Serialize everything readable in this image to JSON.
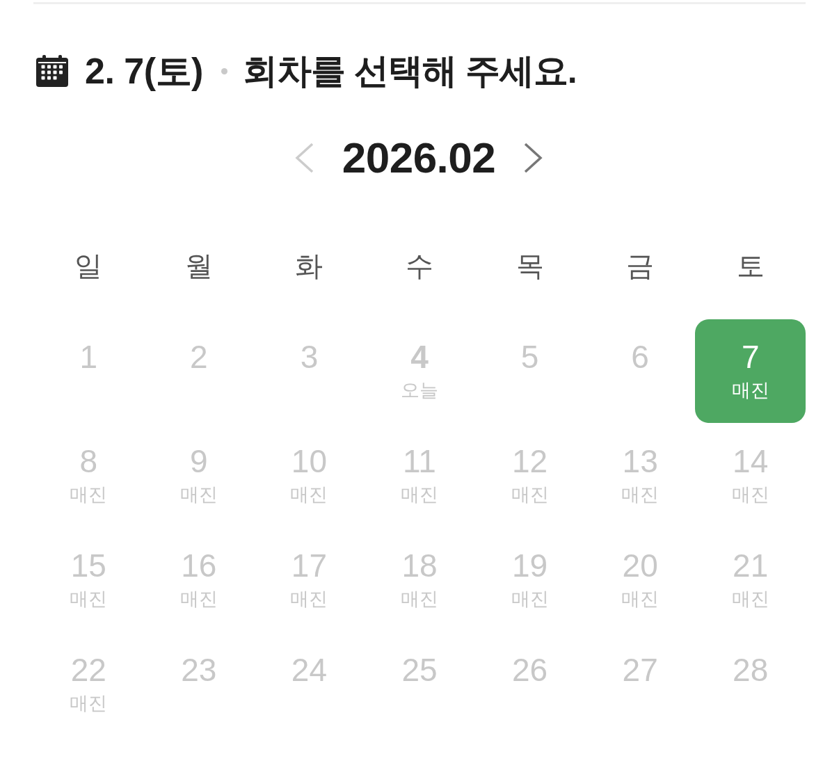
{
  "header": {
    "date": "2. 7(토)",
    "title": "회차를 선택해 주세요."
  },
  "month_nav": {
    "label": "2026.02",
    "prev": {
      "disabled": true
    },
    "next": {
      "disabled": false
    }
  },
  "weekdays": [
    "일",
    "월",
    "화",
    "수",
    "목",
    "금",
    "토"
  ],
  "days": [
    {
      "day": "1",
      "selected": false,
      "today": false
    },
    {
      "day": "2",
      "selected": false,
      "today": false
    },
    {
      "day": "3",
      "selected": false,
      "today": false
    },
    {
      "day": "4",
      "note": "오늘",
      "selected": false,
      "today": true
    },
    {
      "day": "5",
      "selected": false,
      "today": false
    },
    {
      "day": "6",
      "selected": false,
      "today": false
    },
    {
      "day": "7",
      "note": "매진",
      "selected": true,
      "today": false
    },
    {
      "day": "8",
      "note": "매진",
      "selected": false,
      "today": false
    },
    {
      "day": "9",
      "note": "매진",
      "selected": false,
      "today": false
    },
    {
      "day": "10",
      "note": "매진",
      "selected": false,
      "today": false
    },
    {
      "day": "11",
      "note": "매진",
      "selected": false,
      "today": false
    },
    {
      "day": "12",
      "note": "매진",
      "selected": false,
      "today": false
    },
    {
      "day": "13",
      "note": "매진",
      "selected": false,
      "today": false
    },
    {
      "day": "14",
      "note": "매진",
      "selected": false,
      "today": false
    },
    {
      "day": "15",
      "note": "매진",
      "selected": false,
      "today": false
    },
    {
      "day": "16",
      "note": "매진",
      "selected": false,
      "today": false
    },
    {
      "day": "17",
      "note": "매진",
      "selected": false,
      "today": false
    },
    {
      "day": "18",
      "note": "매진",
      "selected": false,
      "today": false
    },
    {
      "day": "19",
      "note": "매진",
      "selected": false,
      "today": false
    },
    {
      "day": "20",
      "note": "매진",
      "selected": false,
      "today": false
    },
    {
      "day": "21",
      "note": "매진",
      "selected": false,
      "today": false
    },
    {
      "day": "22",
      "note": "매진",
      "selected": false,
      "today": false
    },
    {
      "day": "23",
      "selected": false,
      "today": false
    },
    {
      "day": "24",
      "selected": false,
      "today": false
    },
    {
      "day": "25",
      "selected": false,
      "today": false
    },
    {
      "day": "26",
      "selected": false,
      "today": false
    },
    {
      "day": "27",
      "selected": false,
      "today": false
    },
    {
      "day": "28",
      "selected": false,
      "today": false
    }
  ]
}
